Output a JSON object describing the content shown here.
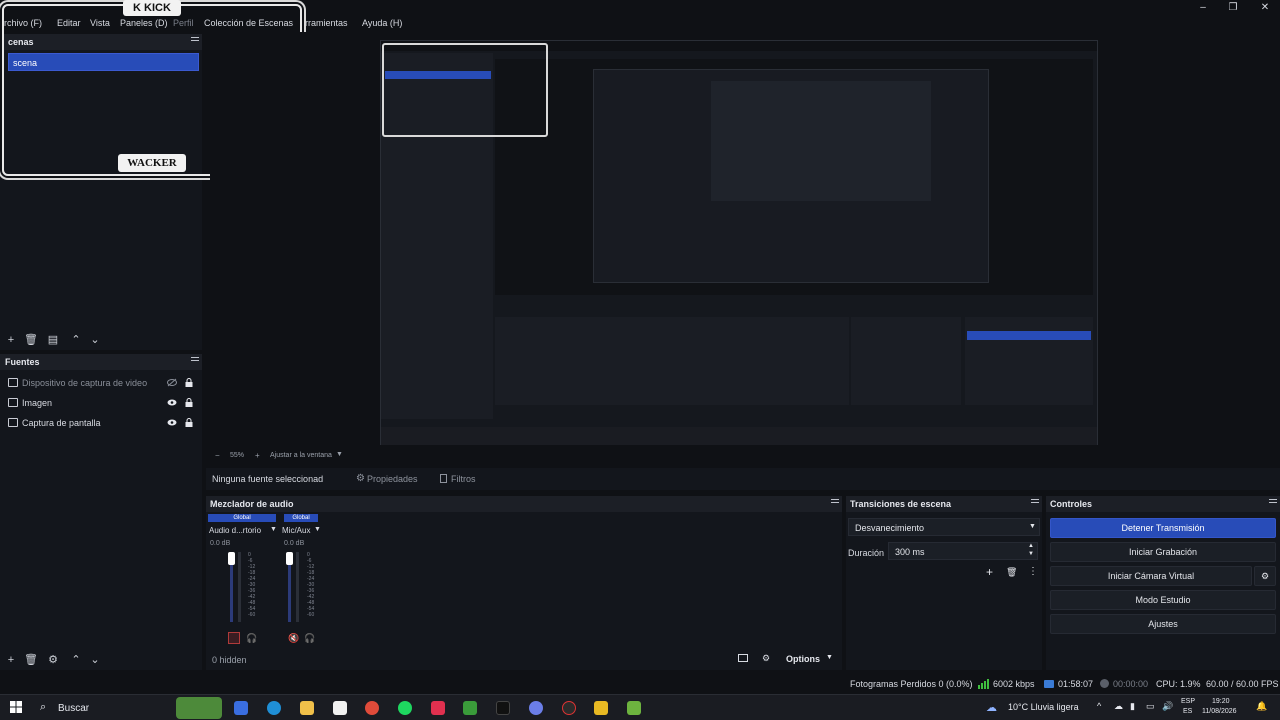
{
  "menubar": {
    "items": [
      "rchivo (F)",
      "Editar",
      "Vista",
      "Paneles (D)",
      "Perfil",
      "Colección de Escenas",
      "erramientas",
      "Ayuda (H)"
    ],
    "window_controls": [
      "–",
      "❐",
      "✕"
    ]
  },
  "overlay": {
    "top_logo": "K KICK",
    "bottom_logo": "WACKER"
  },
  "scenes_dock": {
    "title": "cenas",
    "items": [
      {
        "label": "scena",
        "selected": true
      }
    ]
  },
  "sources_dock": {
    "title": "Fuentes",
    "items": [
      {
        "label": "Dispositivo de captura de video",
        "icon": "camera-icon",
        "hidden": true
      },
      {
        "label": "Imagen",
        "icon": "image-icon",
        "hidden": false
      },
      {
        "label": "Captura de pantalla",
        "icon": "monitor-icon",
        "hidden": false
      }
    ]
  },
  "preview_toolbar": {
    "zoom": "55%",
    "fit": "Ajustar a la ventana"
  },
  "source_bar": {
    "no_source": "Ninguna fuente seleccionad",
    "properties": "Propiedades",
    "filters": "Filtros"
  },
  "audio_mixer": {
    "title": "Mezclador de audio",
    "channels": [
      {
        "badge": "Global",
        "name": "Audio d...rtorio",
        "db": "0.0 dB"
      },
      {
        "badge": "Global",
        "name": "Mic/Aux",
        "db": "0.0 dB"
      }
    ],
    "scale": [
      "0",
      "-6",
      "-12",
      "-18",
      "-24",
      "-30",
      "-36",
      "-42",
      "-48",
      "-54",
      "-60"
    ],
    "hidden_label": "0 hidden",
    "options_label": "Options"
  },
  "transitions": {
    "title": "Transiciones de escena",
    "selected": "Desvanecimiento",
    "duration_label": "Duración",
    "duration_value": "300 ms"
  },
  "controls": {
    "title": "Controles",
    "buttons": [
      "Detener Transmisión",
      "Iniciar Grabación",
      "Iniciar Cámara Virtual",
      "Modo Estudio",
      "Ajustes"
    ]
  },
  "statusbar": {
    "dropped_frames": "Fotogramas Perdidos 0 (0.0%)",
    "bitrate": "6002 kbps",
    "stream_time": "01:58:07",
    "rec_time": "00:00:00",
    "cpu": "CPU: 1.9%",
    "fps": "60.00 / 60.00 FPS"
  },
  "taskbar": {
    "search_placeholder": "Buscar",
    "weather": "10°C Lluvia ligera",
    "lang_top": "ESP",
    "lang_bottom": "ES",
    "time": "19:20",
    "date": "11/08/2026"
  },
  "colors": {
    "accent": "#284cb8",
    "panel": "#13161c",
    "header": "#1c1f26",
    "background": "#0f1115"
  }
}
